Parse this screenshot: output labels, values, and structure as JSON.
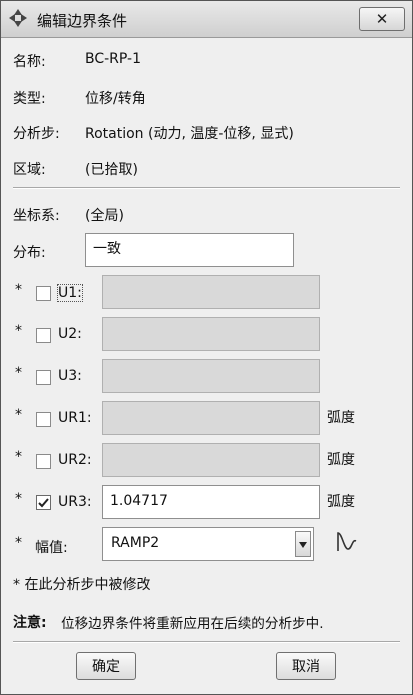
{
  "window": {
    "title": "编辑边界条件",
    "close_icon": "close-icon"
  },
  "info": {
    "name_label": "名称:",
    "name_value": "BC-RP-1",
    "type_label": "类型:",
    "type_value": "位移/转角",
    "step_label": "分析步:",
    "step_value": "Rotation (动力, 温度-位移, 显式)",
    "region_label": "区域:",
    "region_value": "(已拾取)"
  },
  "csys": {
    "label": "坐标系:",
    "value": "(全局)"
  },
  "distribution": {
    "label": "分布:",
    "value": "一致"
  },
  "dofs": [
    {
      "star": "*",
      "label": "U1:",
      "checked": false,
      "value": "",
      "unit": ""
    },
    {
      "star": "*",
      "label": "U2:",
      "checked": false,
      "value": "",
      "unit": ""
    },
    {
      "star": "*",
      "label": "U3:",
      "checked": false,
      "value": "",
      "unit": ""
    },
    {
      "star": "*",
      "label": "UR1:",
      "checked": false,
      "value": "",
      "unit": "弧度"
    },
    {
      "star": "*",
      "label": "UR2:",
      "checked": false,
      "value": "",
      "unit": "弧度"
    },
    {
      "star": "*",
      "label": "UR3:",
      "checked": true,
      "value": "1.04717",
      "unit": "弧度"
    }
  ],
  "amplitude": {
    "star": "*",
    "label": "幅值:",
    "value": "RAMP2",
    "icon": "amplitude-curve-icon"
  },
  "notes": {
    "modified": "* 在此分析步中被修改",
    "notice_label": "注意:",
    "notice_text": "位移边界条件将重新应用在后续的分析步中."
  },
  "buttons": {
    "ok": "确定",
    "cancel": "取消"
  }
}
